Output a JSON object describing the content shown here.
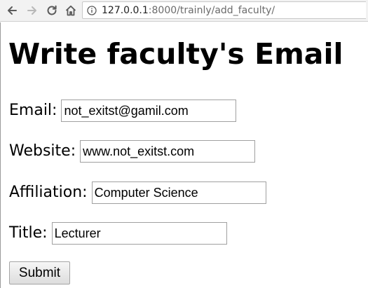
{
  "browser": {
    "url_host": "127.0.0.1",
    "url_rest": ":8000/trainly/add_faculty/",
    "icons": {
      "back": "back-arrow-icon",
      "forward": "forward-arrow-icon",
      "reload": "reload-icon",
      "home": "home-icon",
      "info": "info-icon"
    }
  },
  "page": {
    "title": "Write faculty's Email"
  },
  "form": {
    "email": {
      "label": "Email:",
      "value": "not_exitst@gamil.com"
    },
    "website": {
      "label": "Website:",
      "value": "www.not_exitst.com"
    },
    "affiliation": {
      "label": "Affiliation:",
      "value": "Computer Science"
    },
    "title": {
      "label": "Title:",
      "value": "Lecturer"
    },
    "submit_label": "Submit"
  }
}
